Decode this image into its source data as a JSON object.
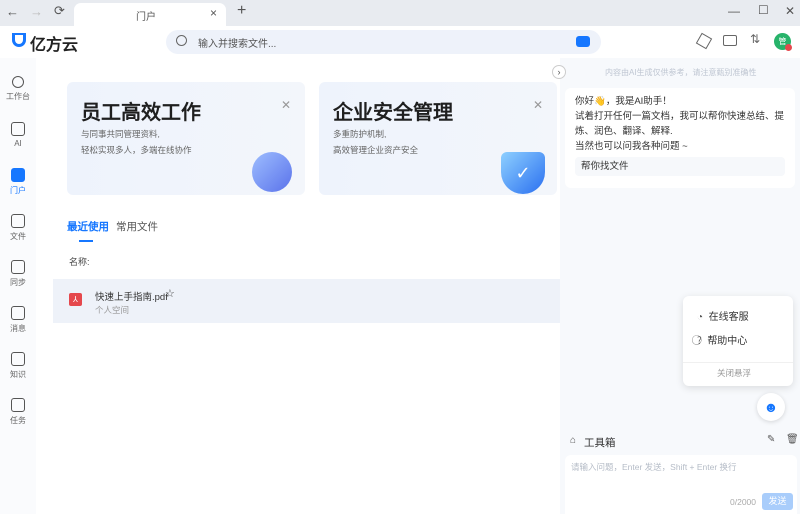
{
  "browser": {
    "tab_title": "门户",
    "new_tab": "+",
    "close": "×",
    "back": "←",
    "forward": "→",
    "reload": "⟳"
  },
  "window": {
    "minimize": "—",
    "maximize": "☐",
    "close": "✕"
  },
  "app": {
    "logo": "亿方云",
    "search_placeholder": "输入并搜索文件...",
    "avatar_text": "管"
  },
  "sidebar": {
    "items": [
      {
        "label": "工作台"
      },
      {
        "label": "AI"
      },
      {
        "label": "门户"
      },
      {
        "label": "文件"
      },
      {
        "label": "同步"
      },
      {
        "label": "消息"
      },
      {
        "label": "知识"
      },
      {
        "label": "任务"
      }
    ]
  },
  "cards": [
    {
      "title": "员工高效工作",
      "line1": "与同事共同管理资料,",
      "line2": "轻松实现多人，多端在线协作"
    },
    {
      "title": "企业安全管理",
      "line1": "多重防护机制,",
      "line2": "高效管理企业资产安全"
    }
  ],
  "tabs": [
    {
      "label": "最近使用"
    },
    {
      "label": "常用文件"
    }
  ],
  "list": {
    "column": "名称:",
    "files": [
      {
        "name": "快速上手指南.pdf",
        "location": "个人空间"
      }
    ]
  },
  "ai_panel": {
    "notice": "内容由AI生成仅供参考，请注意甄别准确性",
    "greeting": "你好👋，我是AI助手！",
    "intro": "试着打开任何一篇文档，我可以帮你快速总结、提炼、润色、翻译、解释.",
    "more": "当然也可以问我各种问题 ~",
    "suggestion": "帮你找文件",
    "toolbox": "工具箱",
    "input_placeholder": "请输入问题，Enter 发送，Shift + Enter 换行",
    "counter": "0/2000",
    "send": "发送"
  },
  "float_menu": {
    "items": [
      {
        "label": "在线客服"
      },
      {
        "label": "帮助中心"
      }
    ],
    "close": "关闭悬浮"
  },
  "colors": {
    "accent": "#1677ff",
    "pdf": "#e5484d"
  }
}
